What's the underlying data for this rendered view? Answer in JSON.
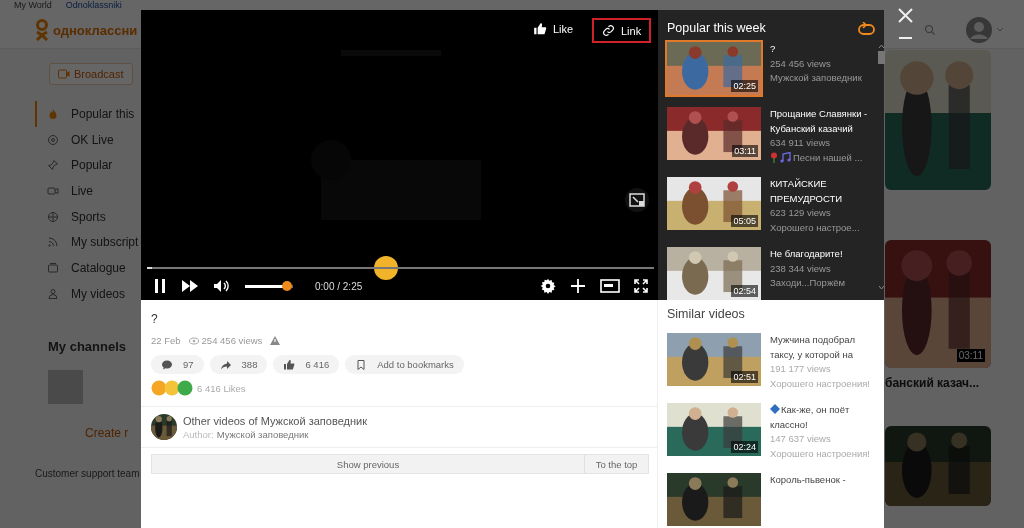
{
  "background": {
    "top_nav": [
      "My World",
      "Odnoklassniki"
    ],
    "logo": "одноклассни",
    "broadcast": "Broadcast",
    "sidebar": [
      {
        "label": "Popular this",
        "selected": true
      },
      {
        "label": "OK Live",
        "selected": false
      },
      {
        "label": "Popular",
        "selected": false
      },
      {
        "label": "Live",
        "selected": false
      },
      {
        "label": "Sports",
        "selected": false
      },
      {
        "label": "My subscript",
        "selected": false
      },
      {
        "label": "Catalogue",
        "selected": false
      },
      {
        "label": "My videos",
        "selected": false
      }
    ],
    "my_channels": "My channels",
    "create": "Create r",
    "support": "Customer support team",
    "tile_duration": "03:11",
    "tile_title": "банский казач..."
  },
  "player": {
    "like": "Like",
    "link": "Link",
    "link_highlighted": true,
    "playing": true,
    "progress": {
      "level": 0.01
    },
    "volume": {
      "level": 0.88
    },
    "time": "0:00 / 2:25"
  },
  "popular": {
    "title": "Popular this week",
    "items": [
      {
        "kind": "plain",
        "title": "?",
        "views": "254 456 views",
        "channel": "Мужской заповедник",
        "duration": "02:25",
        "selected": true
      },
      {
        "kind": "music-channel",
        "title": "Прощание Славянки - Кубанский казачий",
        "views": "634 911 views",
        "channel": "Песни нашей ...",
        "duration": "03:11",
        "selected": false
      },
      {
        "kind": "plain",
        "title": "КИТАЙСКИЕ ПРЕМУДРОСТИ",
        "views": "623 129 views",
        "channel": "Хорошего настрое...",
        "duration": "05:05",
        "selected": false
      },
      {
        "kind": "plain",
        "title": "Не благодарите!",
        "views": "238 344 views",
        "channel": "Заходи...Поржём",
        "duration": "02:54",
        "selected": false
      }
    ]
  },
  "video": {
    "title": "?",
    "date": "22 Feb",
    "views": "254 456 views",
    "actions": [
      {
        "kind": "comment",
        "label": "97"
      },
      {
        "kind": "share",
        "label": "388"
      },
      {
        "kind": "like",
        "label": "6 416"
      },
      {
        "kind": "bookmark",
        "label": "Add to bookmarks"
      }
    ],
    "likes": "6 416 Likes",
    "other_videos": "Other videos of Мужской заповедник",
    "author_label": "Author:",
    "author_name": "Мужской заповедник",
    "show_previous": "Show previous",
    "to_top": "To the top"
  },
  "similar": {
    "title": "Similar videos",
    "items": [
      {
        "kind": "plain",
        "title": "Мужчина подобрал таксу, у которой на",
        "views": "191 177 views",
        "channel": "Хорошего настроения!",
        "duration": "02:51"
      },
      {
        "kind": "diamond-title",
        "title": "Как-же, он поёт классно!",
        "views": "147 637 views",
        "channel": "Хорошего настроения!",
        "duration": "02:24"
      },
      {
        "kind": "plain",
        "title": "Король-пьвенок -"
      }
    ]
  }
}
